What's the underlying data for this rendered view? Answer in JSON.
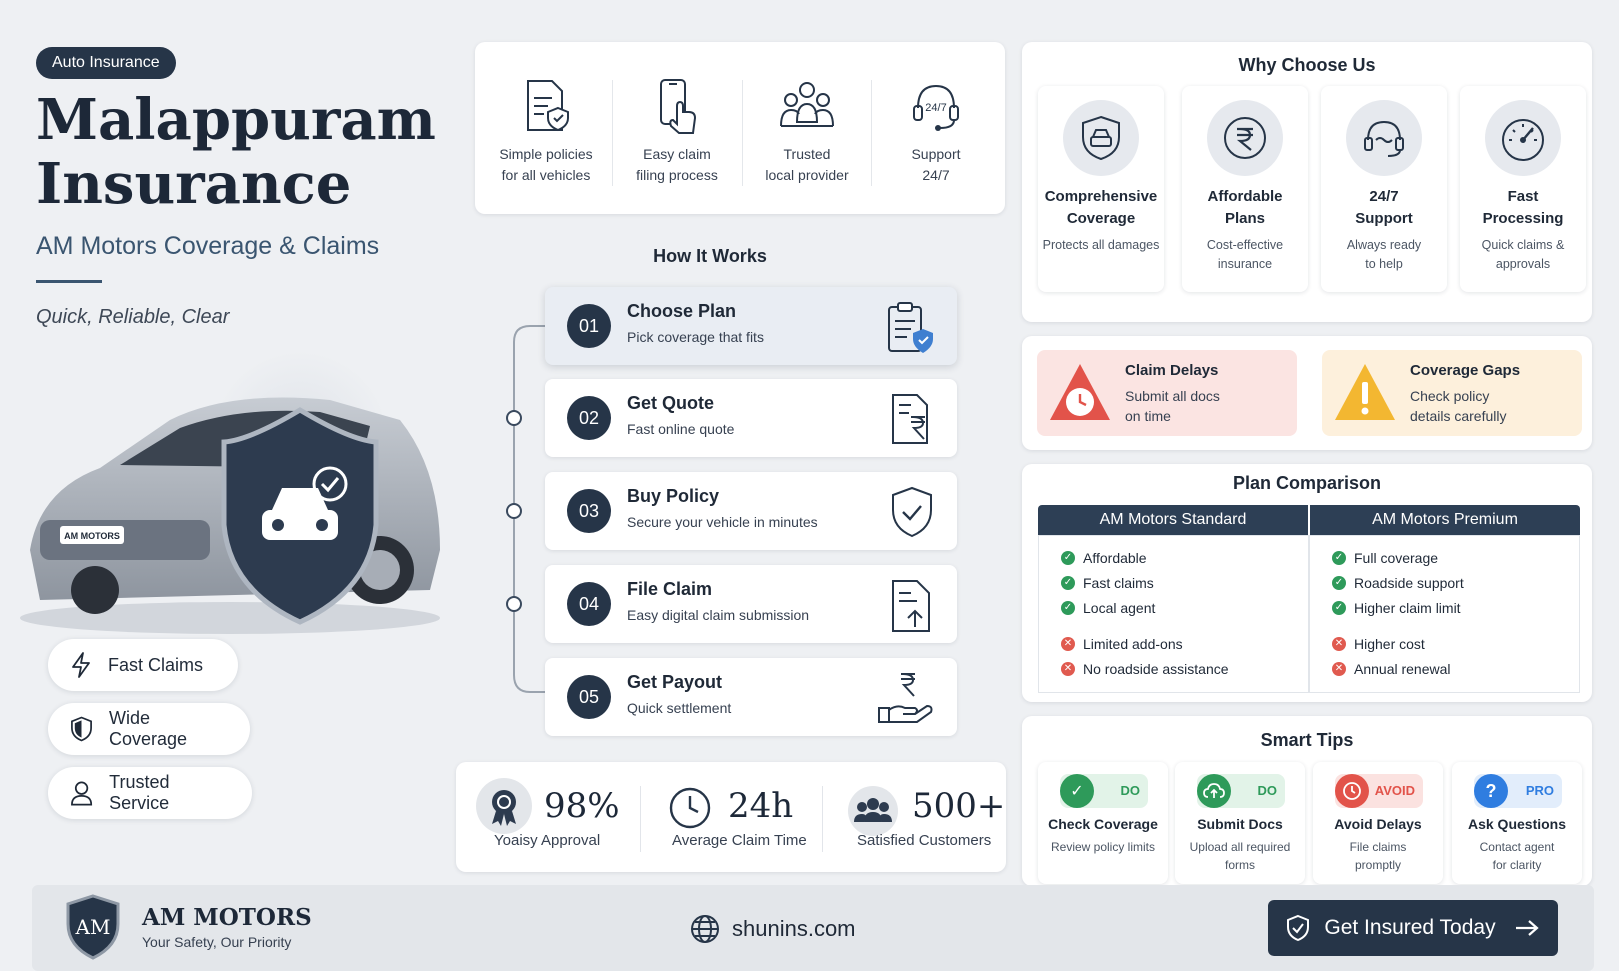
{
  "header": {
    "tag": "Auto Insurance",
    "title_line1": "Malappuram",
    "title_line2": "Insurance",
    "subtitle": "AM Motors Coverage & Claims",
    "tagline": "Quick, Reliable, Clear",
    "plate": "AM MOTORS"
  },
  "pills": [
    {
      "label": "Fast Claims",
      "icon": "lightning-icon"
    },
    {
      "label": "Wide Coverage",
      "icon": "shield-icon"
    },
    {
      "label": "Trusted Service",
      "icon": "user-icon"
    }
  ],
  "features": [
    {
      "line1": "Simple policies",
      "line2": "for all vehicles",
      "icon": "document-shield-icon"
    },
    {
      "line1": "Easy claim",
      "line2": "filing process",
      "icon": "phone-tap-icon"
    },
    {
      "line1": "Trusted",
      "line2": "local provider",
      "icon": "people-icon"
    },
    {
      "line1": "Support",
      "line2": "24/7",
      "icon": "headset-icon"
    }
  ],
  "how": {
    "title": "How It Works",
    "steps": [
      {
        "num": "01",
        "title": "Choose Plan",
        "desc": "Pick coverage that fits",
        "icon": "clipboard-shield-icon"
      },
      {
        "num": "02",
        "title": "Get Quote",
        "desc": "Fast online quote",
        "icon": "rupee-document-icon"
      },
      {
        "num": "03",
        "title": "Buy Policy",
        "desc": "Secure your vehicle in minutes",
        "icon": "shield-check-icon"
      },
      {
        "num": "04",
        "title": "File Claim",
        "desc": "Easy digital claim submission",
        "icon": "document-upload-icon"
      },
      {
        "num": "05",
        "title": "Get Payout",
        "desc": "Quick settlement",
        "icon": "hand-rupee-icon"
      }
    ]
  },
  "stats": [
    {
      "value": "98%",
      "label": "Yoaisy Approval",
      "icon": "award-icon"
    },
    {
      "value": "24h",
      "label": "Average Claim Time",
      "icon": "clock-icon"
    },
    {
      "value": "500+",
      "label": "Satisfied Customers",
      "icon": "users-icon"
    }
  ],
  "why": {
    "title": "Why Choose Us",
    "items": [
      {
        "t1": "Comprehensive",
        "t2": "Coverage",
        "d1": "Protects all damages",
        "d2": "",
        "icon": "car-shield-icon"
      },
      {
        "t1": "Affordable",
        "t2": "Plans",
        "d1": "Cost-effective",
        "d2": "insurance",
        "icon": "rupee-icon"
      },
      {
        "t1": "24/7",
        "t2": "Support",
        "d1": "Always ready",
        "d2": "to help",
        "icon": "headset-icon"
      },
      {
        "t1": "Fast",
        "t2": "Processing",
        "d1": "Quick claims &",
        "d2": "approvals",
        "icon": "speedometer-icon"
      }
    ]
  },
  "alerts": [
    {
      "title": "Claim Delays",
      "d1": "Submit all docs",
      "d2": "on time",
      "icon": "warning-clock-icon",
      "color": "#e2534a",
      "bg": "#fbe4e2"
    },
    {
      "title": "Coverage Gaps",
      "d1": "Check policy",
      "d2": "details carefully",
      "icon": "warning-icon",
      "color": "#f3b731",
      "bg": "#fdf0dc"
    }
  ],
  "plans": {
    "title": "Plan Comparison",
    "standard": {
      "name": "AM Motors Standard",
      "pros": [
        "Affordable",
        "Fast claims",
        "Local agent"
      ],
      "cons": [
        "Limited add-ons",
        "No roadside assistance"
      ]
    },
    "premium": {
      "name": "AM Motors Premium",
      "pros": [
        "Full coverage",
        "Roadside support",
        "Higher claim limit"
      ],
      "cons": [
        "Higher cost",
        "Annual renewal"
      ]
    }
  },
  "tips": {
    "title": "Smart Tips",
    "items": [
      {
        "badge": "DO",
        "title": "Check Coverage",
        "d1": "Review policy limits",
        "d2": "",
        "icon": "check-icon",
        "color": "#2e9a5a",
        "bg": "#e2f3e8"
      },
      {
        "badge": "DO",
        "title": "Submit Docs",
        "d1": "Upload all required",
        "d2": "forms",
        "icon": "cloud-upload-icon",
        "color": "#2e9a5a",
        "bg": "#e2f3e8"
      },
      {
        "badge": "AVOID",
        "title": "Avoid Delays",
        "d1": "File claims",
        "d2": "promptly",
        "icon": "clock-icon",
        "color": "#e2534a",
        "bg": "#fbe2e0"
      },
      {
        "badge": "PRO",
        "title": "Ask Questions",
        "d1": "Contact agent",
        "d2": "for clarity",
        "icon": "question-icon",
        "color": "#2f7de0",
        "bg": "#e2edfb"
      }
    ]
  },
  "footer": {
    "logo_text": "AM",
    "brand": "AM MOTORS",
    "tagline": "Your Safety, Our Priority",
    "website": "shunins.com",
    "cta": "Get Insured Today"
  }
}
